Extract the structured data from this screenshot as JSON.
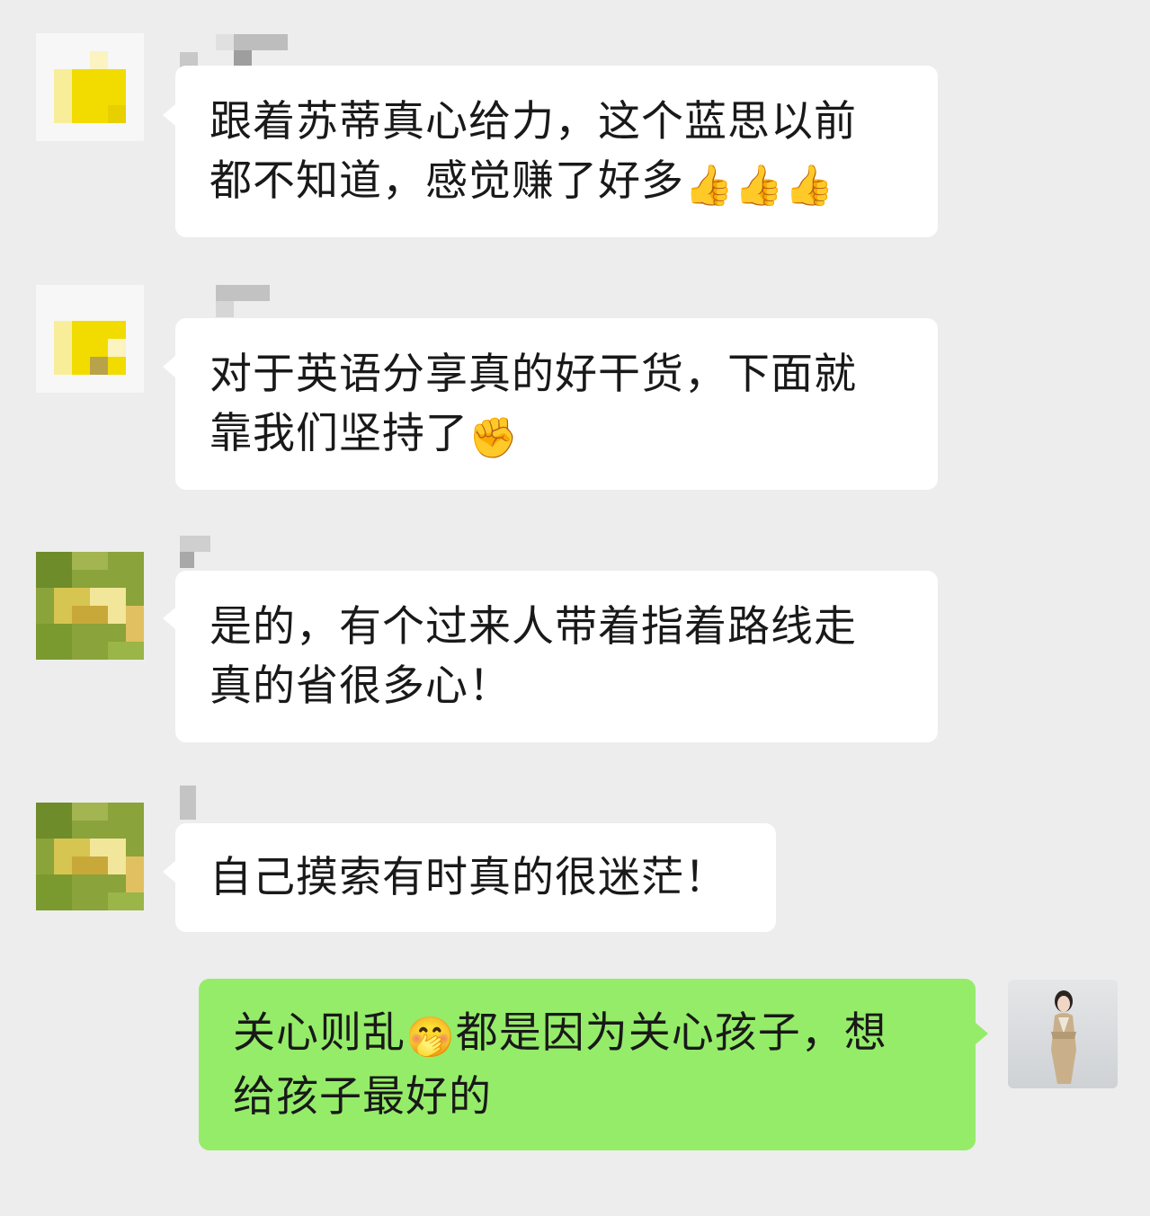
{
  "messages": [
    {
      "id": "m1",
      "side": "left",
      "avatar_type": "yellow-blur",
      "lines": [
        "跟着苏蒂真心给力，这个蓝思以前",
        "都不知道，感觉赚了好多"
      ],
      "emoji": "👍👍👍"
    },
    {
      "id": "m2",
      "side": "left",
      "avatar_type": "yellow-blur",
      "lines": [
        "对于英语分享真的好干货，下面就",
        "靠我们坚持了"
      ],
      "emoji": "✊"
    },
    {
      "id": "m3",
      "side": "left",
      "avatar_type": "green-blur",
      "lines": [
        "是的，有个过来人带着指着路线走",
        "真的省很多心！"
      ]
    },
    {
      "id": "m4",
      "side": "left",
      "avatar_type": "green-blur",
      "lines": [
        "自己摸索有时真的很迷茫！"
      ]
    },
    {
      "id": "m5",
      "side": "right",
      "avatar_type": "photo",
      "line1_before": "关心则乱",
      "line1_emoji": "🤭",
      "line1_after": "都是因为关心孩子，想",
      "line2": "给孩子最好的"
    }
  ],
  "colors": {
    "background": "#ededed",
    "bubble_incoming": "#ffffff",
    "bubble_outgoing": "#95ec69",
    "text": "#191919"
  }
}
